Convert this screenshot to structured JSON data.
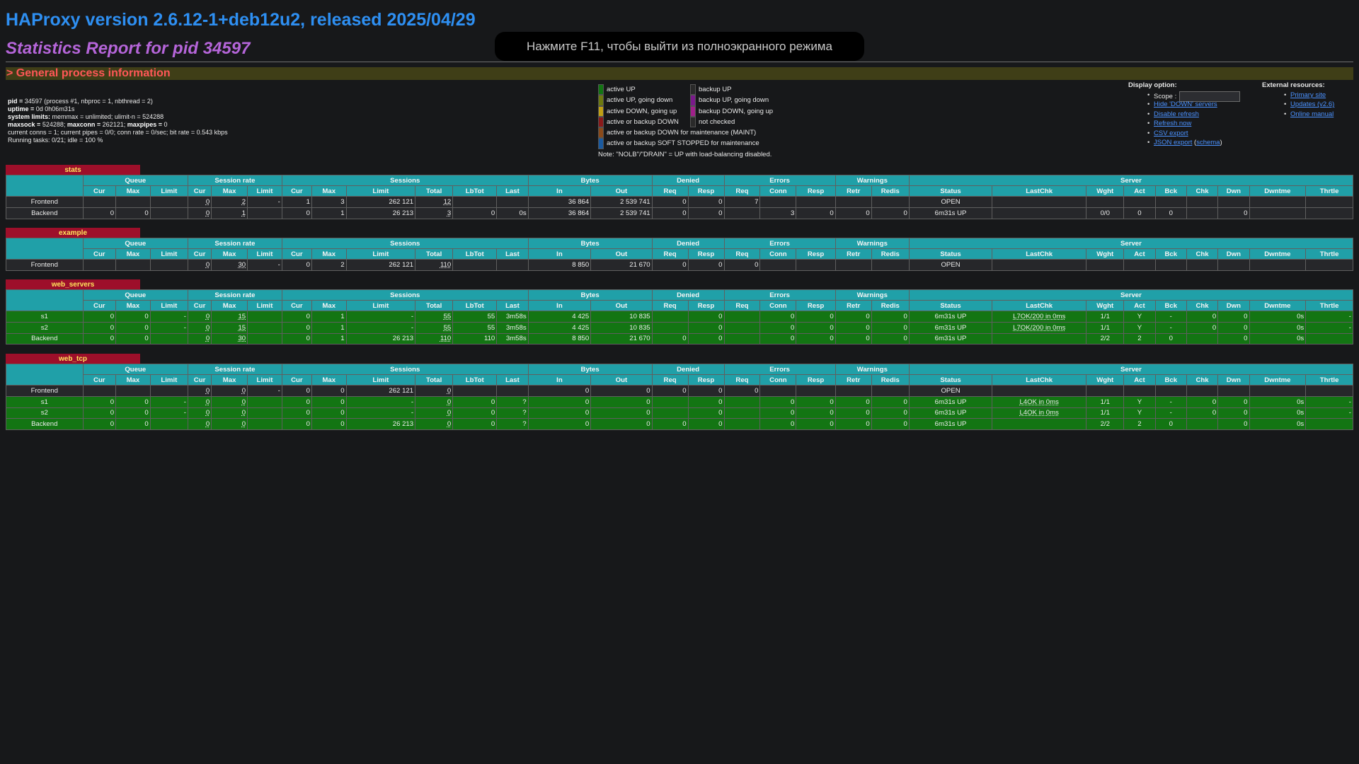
{
  "header": {
    "title": "HAProxy version 2.6.12-1+deb12u2, released 2025/04/29",
    "subtitle": "Statistics Report for pid 34597",
    "fullscreen_notice": "Нажмите F11, чтобы выйти из полноэкранного режима",
    "section": "> General process information"
  },
  "process_info": {
    "pid_label": "pid =",
    "pid_value": "34597 (process #1, nbproc = 1, nbthread = 2)",
    "uptime_label": "uptime =",
    "uptime_value": "0d 0h06m31s",
    "limits_label": "system limits:",
    "limits_value": "memmax = unlimited; ulimit-n = 524288",
    "maxsock_label": "maxsock =",
    "maxsock_value": "524288;",
    "maxconn_label": "maxconn =",
    "maxconn_value": "262121;",
    "maxpipes_label": "maxpipes =",
    "maxpipes_value": "0",
    "current": "current conns = 1; current pipes = 0/0; conn rate = 0/sec; bit rate = 0.543 kbps",
    "tasks": "Running tasks: 0/21; idle = 100 %"
  },
  "legend": {
    "left": [
      {
        "label": "active UP",
        "color": "#137513"
      },
      {
        "label": "active UP, going down",
        "color": "#6e7a10"
      },
      {
        "label": "active DOWN, going up",
        "color": "#c0a015"
      },
      {
        "label": "active or backup DOWN",
        "color": "#8a1a1a"
      },
      {
        "label": "active or backup DOWN for maintenance (MAINT)",
        "color": "#8a4a1a"
      },
      {
        "label": "active or backup SOFT STOPPED for maintenance",
        "color": "#1a5aa0"
      }
    ],
    "right": [
      {
        "label": "backup UP",
        "color": "#2a2a2a"
      },
      {
        "label": "backup UP, going down",
        "color": "#7a1a8a"
      },
      {
        "label": "backup DOWN, going up",
        "color": "#a0208a"
      },
      {
        "label": "not checked",
        "color": "#2a2a2a"
      }
    ],
    "note": "Note: \"NOLB\"/\"DRAIN\" = UP with load-balancing disabled."
  },
  "display_options": {
    "title": "Display option:",
    "scope_label": "Scope :",
    "scope_value": "",
    "links": [
      "Hide 'DOWN' servers",
      "Disable refresh",
      "Refresh now",
      "CSV export",
      "JSON export"
    ],
    "schema_label": "schema"
  },
  "external": {
    "title": "External resources:",
    "links": [
      "Primary site",
      "Updates (v2.6)",
      "Online manual"
    ]
  },
  "columns": {
    "groups": [
      "Queue",
      "Session rate",
      "Sessions",
      "Bytes",
      "Denied",
      "Errors",
      "Warnings",
      "Server"
    ],
    "sub": [
      "Cur",
      "Max",
      "Limit",
      "Cur",
      "Max",
      "Limit",
      "Cur",
      "Max",
      "Limit",
      "Total",
      "LbTot",
      "Last",
      "In",
      "Out",
      "Req",
      "Resp",
      "Req",
      "Conn",
      "Resp",
      "Retr",
      "Redis",
      "Status",
      "LastChk",
      "Wght",
      "Act",
      "Bck",
      "Chk",
      "Dwn",
      "Dwntme",
      "Thrtle"
    ]
  },
  "proxies": [
    {
      "name": "stats",
      "rows": [
        {
          "kind": "fe",
          "cells": [
            "Frontend",
            "",
            "",
            "",
            "0",
            "2",
            "-",
            "1",
            "3",
            "262 121",
            "12",
            "",
            "",
            "36 864",
            "2 539 741",
            "0",
            "0",
            "7",
            "",
            "",
            "",
            "",
            "OPEN",
            "",
            "",
            "",
            "",
            "",
            "",
            "",
            ""
          ]
        },
        {
          "kind": "be",
          "cells": [
            "Backend",
            "0",
            "0",
            "",
            "0",
            "1",
            "",
            "0",
            "1",
            "26 213",
            "3",
            "0",
            "0s",
            "36 864",
            "2 539 741",
            "0",
            "0",
            "",
            "3",
            "0",
            "0",
            "0",
            "6m31s UP",
            "",
            "0/0",
            "0",
            "0",
            "",
            "0",
            "",
            ""
          ]
        }
      ]
    },
    {
      "name": "example",
      "rows": [
        {
          "kind": "fe",
          "cells": [
            "Frontend",
            "",
            "",
            "",
            "0",
            "30",
            "-",
            "0",
            "2",
            "262 121",
            "110",
            "",
            "",
            "8 850",
            "21 670",
            "0",
            "0",
            "0",
            "",
            "",
            "",
            "",
            "OPEN",
            "",
            "",
            "",
            "",
            "",
            "",
            "",
            ""
          ]
        }
      ]
    },
    {
      "name": "web_servers",
      "rows": [
        {
          "kind": "up",
          "cells": [
            "s1",
            "0",
            "0",
            "-",
            "0",
            "15",
            "",
            "0",
            "1",
            "-",
            "55",
            "55",
            "3m58s",
            "4 425",
            "10 835",
            "",
            "0",
            "",
            "0",
            "0",
            "0",
            "0",
            "6m31s UP",
            "L7OK/200 in 0ms",
            "1/1",
            "Y",
            "-",
            "0",
            "0",
            "0s",
            "-"
          ]
        },
        {
          "kind": "up",
          "cells": [
            "s2",
            "0",
            "0",
            "-",
            "0",
            "15",
            "",
            "0",
            "1",
            "-",
            "55",
            "55",
            "3m58s",
            "4 425",
            "10 835",
            "",
            "0",
            "",
            "0",
            "0",
            "0",
            "0",
            "6m31s UP",
            "L7OK/200 in 0ms",
            "1/1",
            "Y",
            "-",
            "0",
            "0",
            "0s",
            "-"
          ]
        },
        {
          "kind": "up",
          "cells": [
            "Backend",
            "0",
            "0",
            "",
            "0",
            "30",
            "",
            "0",
            "1",
            "26 213",
            "110",
            "110",
            "3m58s",
            "8 850",
            "21 670",
            "0",
            "0",
            "",
            "0",
            "0",
            "0",
            "0",
            "6m31s UP",
            "",
            "2/2",
            "2",
            "0",
            "",
            "0",
            "0s",
            ""
          ]
        }
      ]
    },
    {
      "name": "web_tcp",
      "rows": [
        {
          "kind": "fe",
          "cells": [
            "Frontend",
            "",
            "",
            "",
            "0",
            "0",
            "-",
            "0",
            "0",
            "262 121",
            "0",
            "",
            "",
            "0",
            "0",
            "0",
            "0",
            "0",
            "",
            "",
            "",
            "",
            "OPEN",
            "",
            "",
            "",
            "",
            "",
            "",
            "",
            ""
          ]
        },
        {
          "kind": "up",
          "cells": [
            "s1",
            "0",
            "0",
            "-",
            "0",
            "0",
            "",
            "0",
            "0",
            "-",
            "0",
            "0",
            "?",
            "0",
            "0",
            "",
            "0",
            "",
            "0",
            "0",
            "0",
            "0",
            "6m31s UP",
            "L4OK in 0ms",
            "1/1",
            "Y",
            "-",
            "0",
            "0",
            "0s",
            "-"
          ]
        },
        {
          "kind": "up",
          "cells": [
            "s2",
            "0",
            "0",
            "-",
            "0",
            "0",
            "",
            "0",
            "0",
            "-",
            "0",
            "0",
            "?",
            "0",
            "0",
            "",
            "0",
            "",
            "0",
            "0",
            "0",
            "0",
            "6m31s UP",
            "L4OK in 0ms",
            "1/1",
            "Y",
            "-",
            "0",
            "0",
            "0s",
            "-"
          ]
        },
        {
          "kind": "up",
          "cells": [
            "Backend",
            "0",
            "0",
            "",
            "0",
            "0",
            "",
            "0",
            "0",
            "26 213",
            "0",
            "0",
            "?",
            "0",
            "0",
            "0",
            "0",
            "",
            "0",
            "0",
            "0",
            "0",
            "6m31s UP",
            "",
            "2/2",
            "2",
            "0",
            "",
            "0",
            "0s",
            ""
          ]
        }
      ]
    }
  ]
}
